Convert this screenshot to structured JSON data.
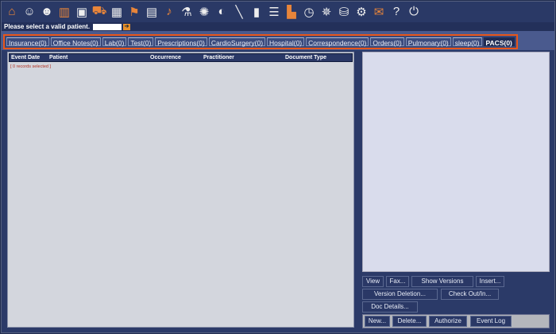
{
  "toolbar": {
    "icons": [
      "home-icon",
      "patient-icon",
      "doctor-icon",
      "chart-icon",
      "monitor-icon",
      "cart-icon",
      "calendar-icon",
      "flag-icon",
      "notepad-icon",
      "stethoscope-icon",
      "flask-icon",
      "virus-icon",
      "pills-icon",
      "syringe-icon",
      "document-new-icon",
      "list-icon",
      "printer-icon",
      "clock-icon",
      "vitruvian-icon",
      "database-icon",
      "gear-icon",
      "mail-icon",
      "help-icon",
      "power-icon"
    ]
  },
  "patient": {
    "label": "Please select a valid patient.",
    "value": ""
  },
  "tabs": [
    {
      "label": "Insurance(0)"
    },
    {
      "label": "Office Notes(0)"
    },
    {
      "label": "Lab(0)"
    },
    {
      "label": "Test(0)"
    },
    {
      "label": "Prescriptions(0)"
    },
    {
      "label": "CardioSurgery(0)"
    },
    {
      "label": "Hospital(0)"
    },
    {
      "label": "Correspondence(0)"
    },
    {
      "label": "Orders(0)"
    },
    {
      "label": "Pulmonary(0)"
    },
    {
      "label": "sleep(0)"
    },
    {
      "label": "PACS(0)",
      "active": true
    }
  ],
  "table": {
    "columns": [
      "Event Date",
      "Patient",
      "Occurrence",
      "Practitioner",
      "Document Type"
    ],
    "status": "[ 0 records selected ]"
  },
  "buttons": {
    "view": "View",
    "fax": "Fax...",
    "show_versions": "Show Versions",
    "insert": "Insert...",
    "version_deletion": "Version Deletion...",
    "check_out": "Check Out/In...",
    "doc_details": "Doc Details...",
    "new": "New...",
    "delete": "Delete...",
    "authorize": "Authorize",
    "event_log": "Event Log"
  },
  "colors": {
    "accent": "#e8561a",
    "navy": "#2b3a68"
  }
}
